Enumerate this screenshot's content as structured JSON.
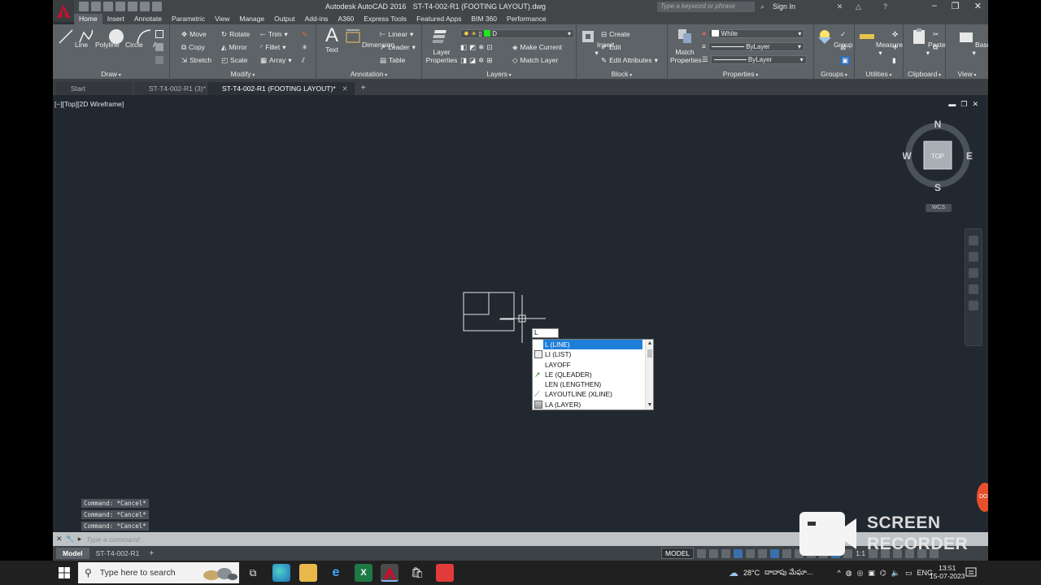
{
  "window": {
    "app_title": "Autodesk AutoCAD 2016",
    "file_title": "ST-T4-002-R1 (FOOTING LAYOUT).dwg",
    "search_placeholder": "Type a keyword or phrase",
    "sign_in": "Sign In"
  },
  "ribbon_tabs": [
    "Home",
    "Insert",
    "Annotate",
    "Parametric",
    "View",
    "Manage",
    "Output",
    "Add-ins",
    "A360",
    "Express Tools",
    "Featured Apps",
    "BIM 360",
    "Performance"
  ],
  "ribbon": {
    "draw": {
      "title": "Draw",
      "line": "Line",
      "polyline": "Polyline",
      "circle": "Circle",
      "arc": "Arc"
    },
    "modify": {
      "title": "Modify",
      "move": "Move",
      "rotate": "Rotate",
      "trim": "Trim",
      "copy": "Copy",
      "mirror": "Mirror",
      "fillet": "Fillet",
      "stretch": "Stretch",
      "scale": "Scale",
      "array": "Array"
    },
    "annotation": {
      "title": "Annotation",
      "text": "Text",
      "dimension": "Dimension",
      "linear": "Linear",
      "leader": "Leader",
      "table": "Table"
    },
    "layers": {
      "title": "Layers",
      "layer_properties": "Layer Properties",
      "current_layer": "D",
      "make_current": "Make Current",
      "match_layer": "Match Layer"
    },
    "block": {
      "title": "Block",
      "insert": "Insert",
      "create": "Create",
      "edit": "Edit",
      "edit_attributes": "Edit Attributes"
    },
    "properties": {
      "title": "Properties",
      "match_properties": "Match Properties",
      "color": "White",
      "linetype": "ByLayer",
      "lineweight": "ByLayer"
    },
    "groups": {
      "title": "Groups",
      "group": "Group"
    },
    "utilities": {
      "title": "Utilities",
      "measure": "Measure"
    },
    "clipboard": {
      "title": "Clipboard",
      "paste": "Paste"
    },
    "view": {
      "title": "View",
      "base": "Base"
    }
  },
  "file_tabs": [
    "Start",
    "ST-T4-002-R1 (3)*",
    "ST-T4-002-R1 (FOOTING LAYOUT)*"
  ],
  "viewport": {
    "label": "[−][Top][2D Wireframe]",
    "viewcube": {
      "n": "N",
      "s": "S",
      "e": "E",
      "w": "W",
      "face": "TOP"
    },
    "wcs": "WCS"
  },
  "command_input": "L",
  "autocomplete": [
    {
      "label": "L (LINE)",
      "selected": true,
      "icon": "line-icon"
    },
    {
      "label": "LI (LIST)",
      "selected": false,
      "icon": "list-icon"
    },
    {
      "label": "LAYOFF",
      "selected": false,
      "icon": "layoff-icon"
    },
    {
      "label": "LE (QLEADER)",
      "selected": false,
      "icon": "qleader-icon"
    },
    {
      "label": "LEN (LENGTHEN)",
      "selected": false,
      "icon": ""
    },
    {
      "label": "LAYOUTLINE (XLINE)",
      "selected": false,
      "icon": "xline-icon"
    },
    {
      "label": "LA (LAYER)",
      "selected": false,
      "icon": "layer-icon"
    }
  ],
  "command_history": [
    "Command: *Cancel*",
    "Command: *Cancel*",
    "Command: *Cancel*"
  ],
  "command_prompt": "Type a command",
  "layout_tabs": [
    "Model",
    "ST-T4-002-R1"
  ],
  "status": {
    "model": "MODEL",
    "scale": "1:1"
  },
  "watermark": {
    "line1": "SCREEN",
    "line2": "RECORDER"
  },
  "taskbar": {
    "search": "Type here to search",
    "weather": "28°C",
    "weather_text": "దాదాపు మేఘా...",
    "lang": "ENG",
    "time": "13:51",
    "date": "15-07-2023"
  },
  "colors": {
    "accent": "#1e7fd8",
    "viewport_bg": "#212830",
    "ribbon_bg": "#5d6366",
    "logo_red": "#c8102e"
  }
}
